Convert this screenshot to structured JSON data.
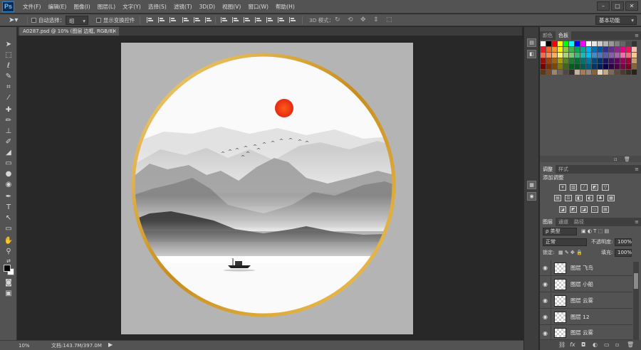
{
  "app": {
    "logo": "Ps"
  },
  "menu": [
    "文件(F)",
    "编辑(E)",
    "图像(I)",
    "图层(L)",
    "文字(Y)",
    "选择(S)",
    "滤镜(T)",
    "3D(D)",
    "视图(V)",
    "窗口(W)",
    "帮助(H)"
  ],
  "window_controls": {
    "minimize": "–",
    "maximize": "□",
    "close": "✕"
  },
  "options": {
    "auto_select_label": "自动选择：",
    "auto_select_value": "组",
    "show_transform_label": "显示变换控件",
    "mode_3d_label": "3D 模式：",
    "workspace": "基本功能"
  },
  "document": {
    "tab_title": "A0287.psd @ 10% (图层 边框, RGB/8)",
    "tab_close": "×"
  },
  "status": {
    "zoom": "10%",
    "doc_info": "文档:143.7M/397.0M",
    "arrow": "▶"
  },
  "panels": {
    "color_tabs": [
      "颜色",
      "色板"
    ],
    "adjust_tabs": [
      "调整",
      "样式"
    ],
    "adjust_title": "添加调整",
    "layers_tabs": [
      "图层",
      "通道",
      "路径"
    ],
    "filter_kind": "ρ 类型",
    "blend_mode": "正常",
    "opacity_label": "不透明度:",
    "opacity_value": "100%",
    "lock_label": "锁定:",
    "fill_label": "填充:",
    "fill_value": "100%",
    "menu_icon": "≡"
  },
  "layers": [
    {
      "name": "图层 飞鸟",
      "visible": true
    },
    {
      "name": "图层 小船",
      "visible": true
    },
    {
      "name": "图层 云雾",
      "visible": true
    },
    {
      "name": "图层 12",
      "visible": true
    },
    {
      "name": "图层 云雾",
      "visible": true
    }
  ],
  "swatches": [
    "#ffffff",
    "#000000",
    "#ff0000",
    "#ffff00",
    "#00ff00",
    "#00ffff",
    "#0000ff",
    "#ff00ff",
    "#ffffff",
    "#e6e6e6",
    "#cccccc",
    "#b3b3b3",
    "#999999",
    "#808080",
    "#666666",
    "#4d4d4d",
    "#333333",
    "#ed1c24",
    "#f26522",
    "#f7941d",
    "#fff200",
    "#8dc63f",
    "#39b54a",
    "#00a651",
    "#00a99d",
    "#00aeef",
    "#0072bc",
    "#0054a6",
    "#2e3192",
    "#662d91",
    "#92278f",
    "#ec008c",
    "#ed145b",
    "#f9c0b0",
    "#f26c4f",
    "#f68e55",
    "#fbaf5c",
    "#fff568",
    "#acd373",
    "#7cc576",
    "#3bb878",
    "#1abbb4",
    "#00bff3",
    "#438ccb",
    "#5574b9",
    "#605ca8",
    "#8560a8",
    "#a864a8",
    "#f06eaa",
    "#f26d7d",
    "#fdc68a",
    "#9e0b0f",
    "#a0410d",
    "#a3620a",
    "#aba000",
    "#598527",
    "#197b30",
    "#007236",
    "#00746b",
    "#0076a3",
    "#004b80",
    "#003471",
    "#1b1464",
    "#440e62",
    "#630460",
    "#9e005d",
    "#9e0039",
    "#c69c6d",
    "#790000",
    "#7b2e00",
    "#7d4900",
    "#827b00",
    "#406618",
    "#005e20",
    "#005826",
    "#005952",
    "#005b7f",
    "#003663",
    "#002157",
    "#0d004c",
    "#32004b",
    "#4b0049",
    "#7b0046",
    "#7a0026",
    "#8c6239",
    "#603913",
    "#754c24",
    "#998675",
    "#736357",
    "#534741",
    "#362f2d",
    "#c7b299",
    "#a67c52",
    "#9b8579",
    "#8c6239",
    "#e8d7c0",
    "#c4a882",
    "#7d6b5a",
    "#5e4a3a",
    "#4a3b2f",
    "#3a2e25",
    "#2a211b"
  ]
}
